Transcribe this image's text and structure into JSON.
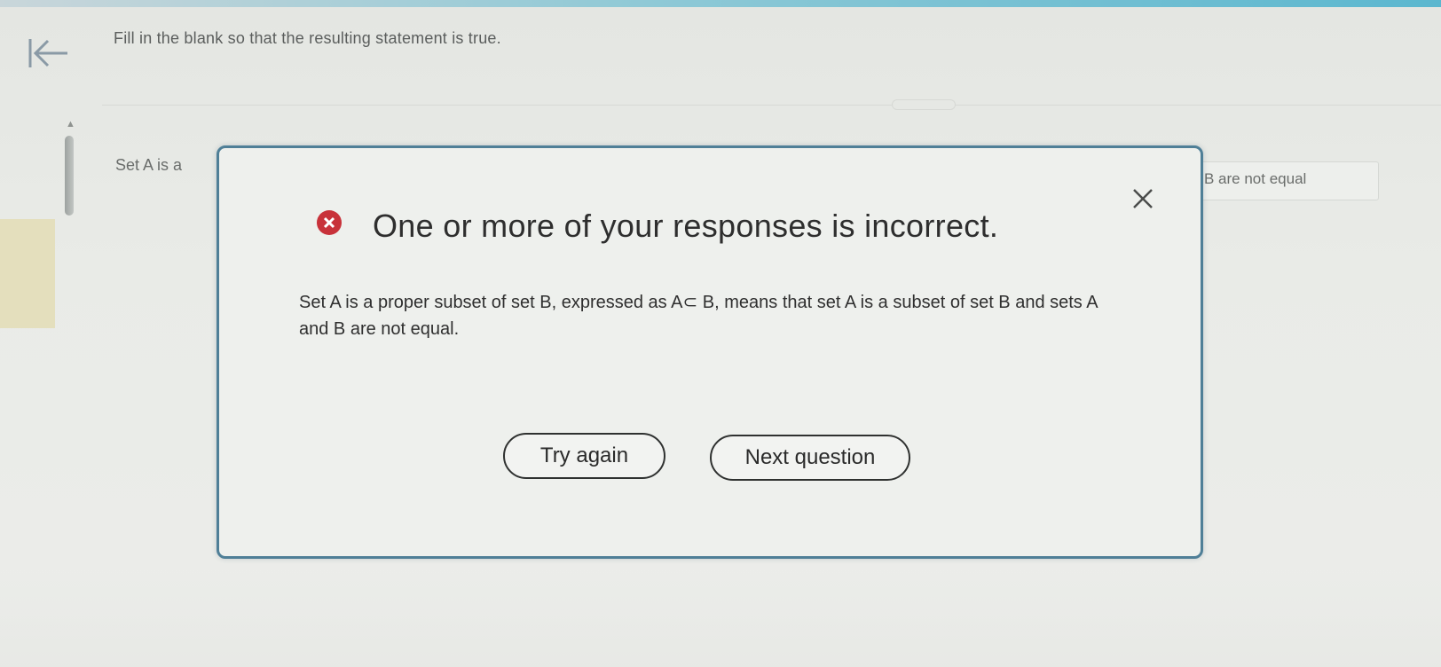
{
  "header": {
    "instruction": "Fill in the blank so that the resulting statement is true."
  },
  "question": {
    "prefix": "Set A is a",
    "suffix": "B are not equal"
  },
  "modal": {
    "title": "One or more of your responses is incorrect.",
    "body": "Set A is a proper subset of set B, expressed as A⊂ B, means that set A is a subset of set B and sets A and B are not equal.",
    "try_again_label": "Try again",
    "next_question_label": "Next question"
  },
  "icons": {
    "back": "back-arrow-icon",
    "close": "close-icon",
    "error": "error-icon"
  },
  "colors": {
    "modal_border": "#4f7f97",
    "error_red": "#c8323a",
    "top_accent": "#5bb7cf"
  }
}
